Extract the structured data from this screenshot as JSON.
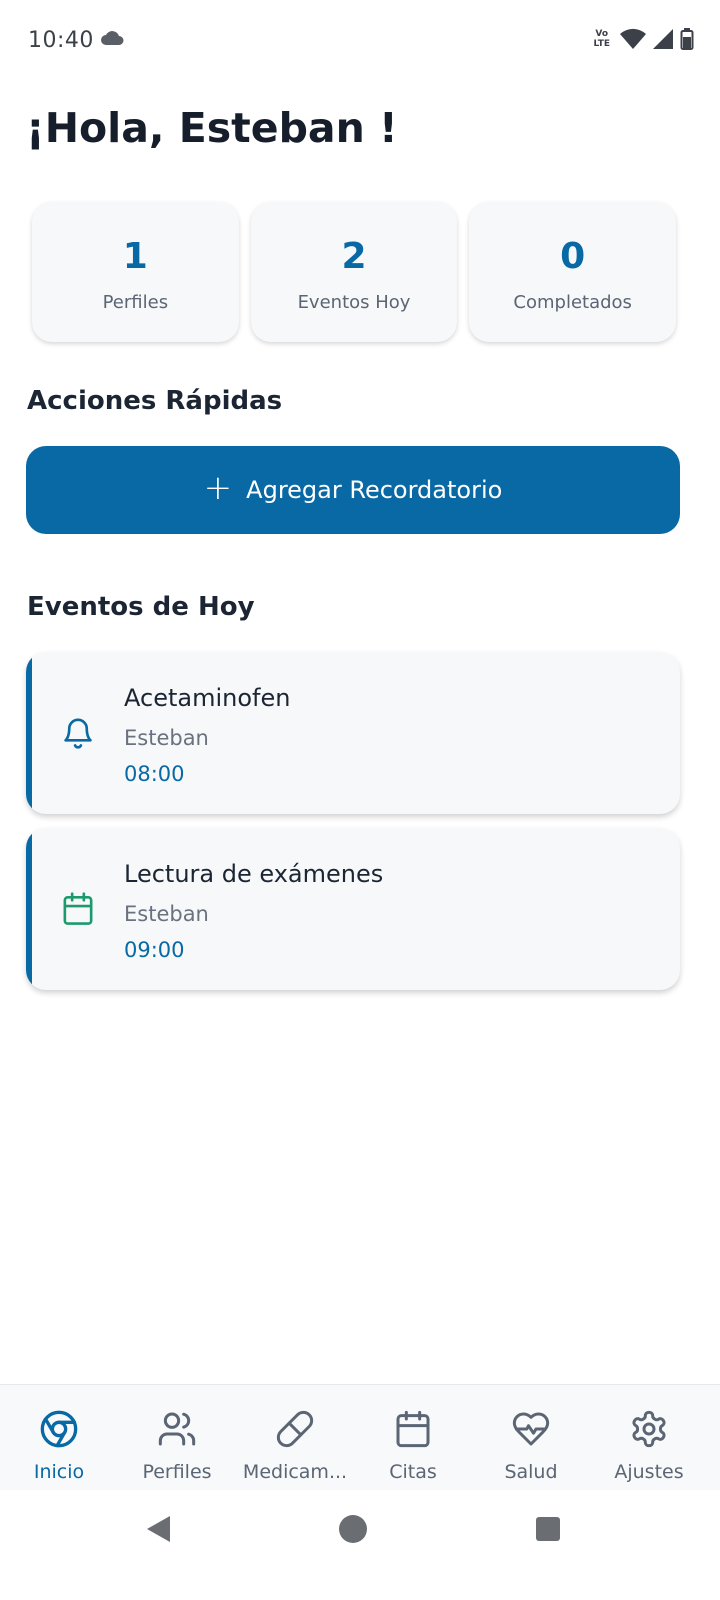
{
  "status_bar": {
    "time": "10:40",
    "network_label_top": "Vo",
    "network_label_bottom": "LTE"
  },
  "greeting": "¡Hola, Esteban !",
  "stats": [
    {
      "value": "1",
      "label": "Perfiles"
    },
    {
      "value": "2",
      "label": "Eventos Hoy"
    },
    {
      "value": "0",
      "label": "Completados"
    }
  ],
  "quick_actions": {
    "title": "Acciones Rápidas",
    "add_reminder_label": "Agregar Recordatorio"
  },
  "events": {
    "title": "Eventos de Hoy",
    "items": [
      {
        "title": "Acetaminofen",
        "person": "Esteban",
        "time": "08:00",
        "icon": "bell-icon",
        "icon_color": "#0869a4"
      },
      {
        "title": "Lectura de exámenes",
        "person": "Esteban",
        "time": "09:00",
        "icon": "calendar-icon",
        "icon_color": "#1d9a6c"
      }
    ]
  },
  "bottom_nav": [
    {
      "label": "Inicio",
      "icon": "home-icon",
      "active": true
    },
    {
      "label": "Perfiles",
      "icon": "users-icon",
      "active": false
    },
    {
      "label": "Medicam...",
      "icon": "pill-icon",
      "active": false
    },
    {
      "label": "Citas",
      "icon": "calendar-icon",
      "active": false
    },
    {
      "label": "Salud",
      "icon": "heart-pulse-icon",
      "active": false
    },
    {
      "label": "Ajustes",
      "icon": "gear-icon",
      "active": false
    }
  ],
  "colors": {
    "primary": "#0869a4",
    "success": "#1d9a6c",
    "card_bg": "#f6f8fa"
  }
}
